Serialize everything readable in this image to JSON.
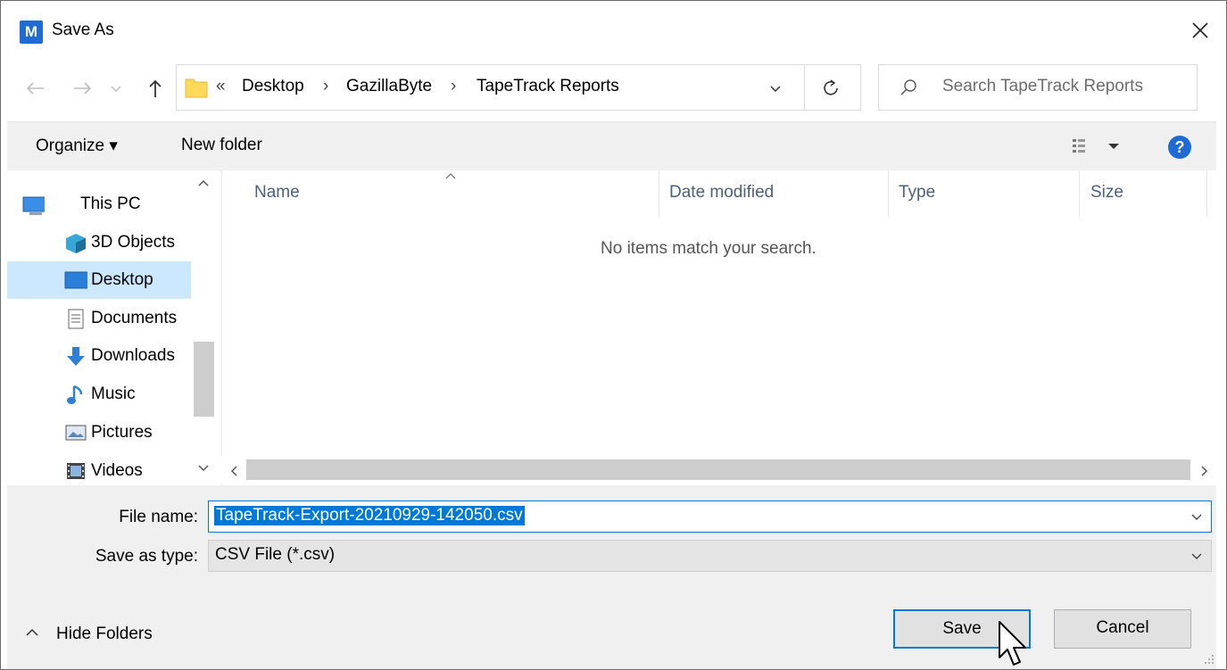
{
  "window": {
    "title": "Save As",
    "app_icon_letter": "M"
  },
  "address": {
    "overflow_glyph": "«",
    "crumbs": [
      "Desktop",
      "GazillaByte",
      "TapeTrack Reports"
    ]
  },
  "search": {
    "placeholder": "Search TapeTrack Reports"
  },
  "commandbar": {
    "organize_label": "Organize ▾",
    "new_folder_label": "New folder"
  },
  "navpane": {
    "items": [
      {
        "label": "This PC",
        "icon": "this-pc-icon"
      },
      {
        "label": "3D Objects",
        "icon": "3d-objects-icon"
      },
      {
        "label": "Desktop",
        "icon": "desktop-icon",
        "selected": true
      },
      {
        "label": "Documents",
        "icon": "documents-icon"
      },
      {
        "label": "Downloads",
        "icon": "downloads-icon"
      },
      {
        "label": "Music",
        "icon": "music-icon"
      },
      {
        "label": "Pictures",
        "icon": "pictures-icon"
      },
      {
        "label": "Videos",
        "icon": "videos-icon"
      }
    ]
  },
  "filelist": {
    "columns": [
      "Name",
      "Date modified",
      "Type",
      "Size"
    ],
    "empty_message": "No items match your search."
  },
  "form": {
    "file_name_label": "File name:",
    "file_name_value": "TapeTrack-Export-20210929-142050.csv",
    "save_type_label": "Save as type:",
    "save_type_value": "CSV File (*.csv)"
  },
  "footer": {
    "hide_folders_label": "Hide Folders",
    "save_label": "Save",
    "cancel_label": "Cancel"
  },
  "colors": {
    "accent": "#0078d7",
    "selected_nav": "#cce8ff",
    "dialog_bg": "#f0f0f0",
    "help_icon": "#1e6bd6"
  }
}
